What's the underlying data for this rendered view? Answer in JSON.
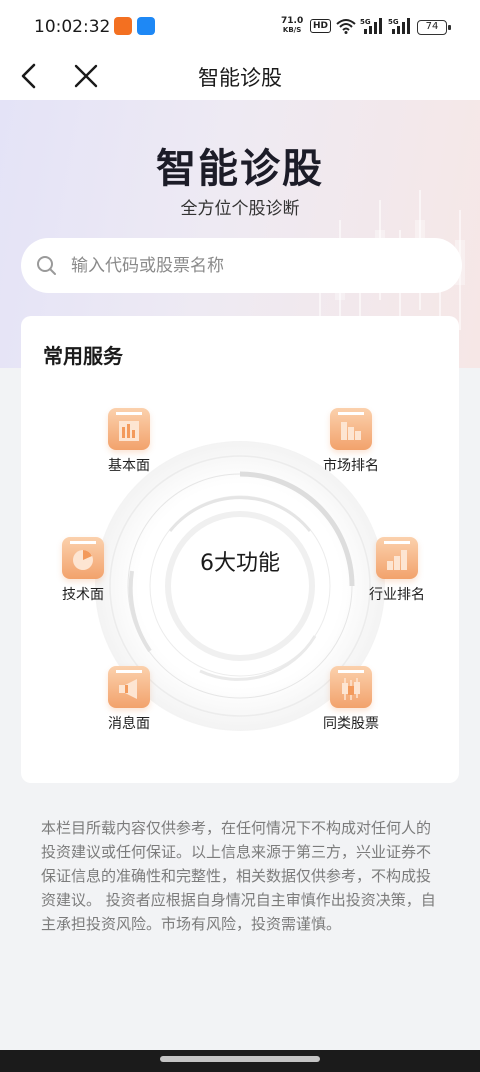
{
  "status_bar": {
    "time": "10:02:32",
    "net_speed_value": "71.0",
    "net_speed_unit": "KB/S",
    "hd_label": "HD",
    "signal_1": "5G",
    "signal_2": "5G",
    "battery": "74"
  },
  "nav": {
    "title": "智能诊股",
    "back_icon": "chevron-left-icon",
    "close_icon": "close-icon"
  },
  "hero": {
    "title": "智能诊股",
    "subtitle": "全方位个股诊断"
  },
  "search": {
    "placeholder": "输入代码或股票名称",
    "value": ""
  },
  "services": {
    "title": "常用服务",
    "center_label": "6大功能",
    "items": [
      {
        "label": "基本面",
        "icon": "fundamentals-chart-icon"
      },
      {
        "label": "市场排名",
        "icon": "market-ranking-icon"
      },
      {
        "label": "技术面",
        "icon": "pie-chart-icon"
      },
      {
        "label": "行业排名",
        "icon": "industry-ranking-icon"
      },
      {
        "label": "消息面",
        "icon": "megaphone-icon"
      },
      {
        "label": "同类股票",
        "icon": "candlestick-icon"
      }
    ]
  },
  "disclaimer": "本栏目所载内容仅供参考，在任何情况下不构成对任何人的投资建议或任何保证。以上信息来源于第三方，兴业证券不保证信息的准确性和完整性，相关数据仅供参考，不构成投资建议。 投资者应根据自身情况自主审慎作出投资决策，自主承担投资风险。市场有风险，投资需谨慎。",
  "colors": {
    "accent": "#f2a26c",
    "accent_light": "#fbd1ad",
    "background": "#f2f3f5"
  }
}
